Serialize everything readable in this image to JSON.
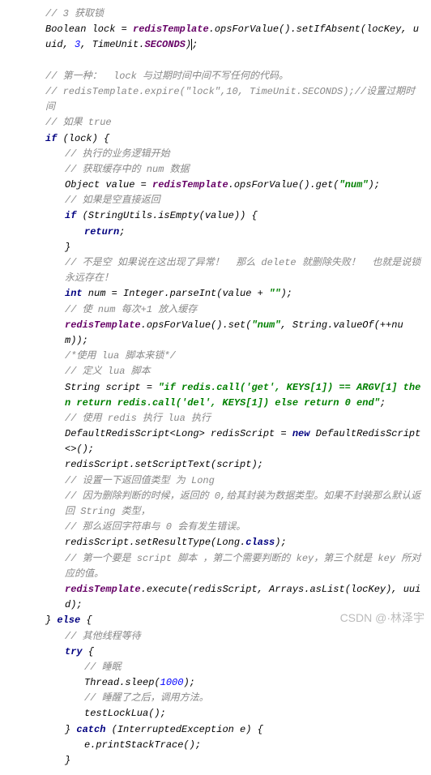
{
  "c": {
    "l1": "// 3 获取锁",
    "l4a": "// 第一种：  lock 与过期时间中间不写任何的代码。",
    "l4b": "// redisTemplate.expire(\"lock\",10, TimeUnit.SECONDS);//设置过期时间",
    "l5": "// 如果 true",
    "l7": "// 执行的业务逻辑开始",
    "l8": "// 获取缓存中的 num 数据",
    "l10": "// 如果是空直接返回",
    "l14": "// 不是空 如果说在这出现了异常！  那么 delete 就删除失败！  也就是说锁永远存在！",
    "l16": "// 使 num 每次+1 放入缓存",
    "l18": "/*使用 lua 脚本来锁*/",
    "l19": "// 定义 lua 脚本",
    "l21": "// 使用 redis 执行 lua 执行",
    "l24": "// 设置一下返回值类型 为 Long",
    "l25": "// 因为删除判断的时候，返回的 0,给其封装为数据类型。如果不封装那么默认返回 String 类型，",
    "l26": "// 那么返回字符串与 0 会有发生错误。",
    "l28": "// 第一个要是 script 脚本 ，第二个需要判断的 key，第三个就是 key 所对应的值。",
    "l31": "// 其他线程等待",
    "l33": "// 睡眠",
    "l35": "// 睡醒了之后，调用方法。"
  },
  "kw": {
    "if": "if",
    "return": "return",
    "int": "int",
    "new": "new",
    "else": "else",
    "try": "try",
    "catch": "catch",
    "class": "class"
  },
  "t": {
    "l2a": "Boolean lock = ",
    "l2c": ".opsForValue().setIfAbsent(locKey, uuid, ",
    "l2e": ", TimeUnit.",
    "l2g": ")",
    "l6": " (lock) {",
    "l9a": "Object value = ",
    "l9c": ".opsForValue().get(",
    "l9e": ");",
    "l11a": " (StringUtils.",
    "l11b": "isEmpty",
    "l11c": "(value)) {",
    "l12b": ";",
    "l13": "}",
    "l15a": " num = Integer.",
    "l15b": "parseInt",
    "l15c": "(value + ",
    "l15e": ");",
    "l17b": ".opsForValue().set(",
    "l17d": ", String.",
    "l17e": "valueOf",
    "l17f": "(++num));",
    "l20a": "String script = ",
    "l20c": ";",
    "l22a": "DefaultRedisScript<Long> redisScript = ",
    "l22c": " DefaultRedisScript<>();",
    "l23": "redisScript.setScriptText(script);",
    "l27a": "redisScript.setResultType(Long.",
    "l27c": ");",
    "l29b": ".execute(redisScript, Arrays.",
    "l29c": "asList",
    "l29d": "(locKey), uuid);",
    "l30a": "} ",
    "l30c": " {",
    "l32b": " {",
    "l34a": "Thread.",
    "l34b": "sleep",
    "l34c": "(",
    "l34e": ");",
    "l36": "testLockLua();",
    "l37a": "} ",
    "l37c": " (InterruptedException e) {",
    "l38": "e.printStackTrace();",
    "l39": "}"
  },
  "s": {
    "num": "\"num\"",
    "empty": "\"\"",
    "script": "\"if redis.call('get', KEYS[1]) == ARGV[1] then return redis.call('del', KEYS[1]) else return 0 end\""
  },
  "n": {
    "three": "3",
    "thousand": "1000"
  },
  "p": {
    "redisTemplate": "redisTemplate",
    "seconds": "SECONDS"
  },
  "wm": "CSDN @·林泽宇"
}
